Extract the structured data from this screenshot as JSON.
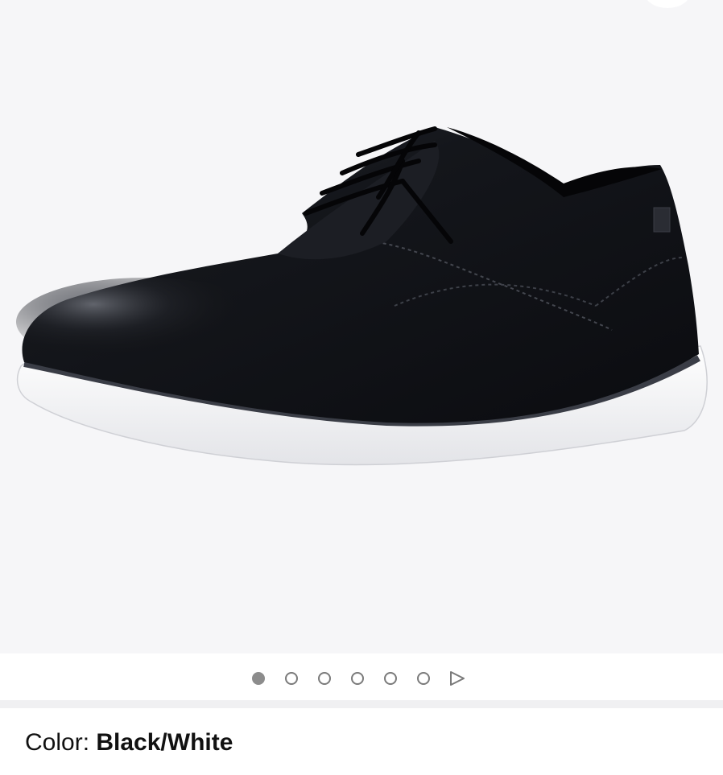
{
  "gallery": {
    "image_alt": "Black leather lace-up shoe with white sole",
    "total_images": 6,
    "current_index": 0,
    "next_icon": "play-triangle-icon"
  },
  "color": {
    "label": "Color:",
    "value": "Black/White"
  },
  "colors": {
    "gallery_bg": "#f6f6f8",
    "dot_active": "#8c8c8c",
    "dot_inactive_border": "#7a7a7a",
    "text": "#111111"
  }
}
